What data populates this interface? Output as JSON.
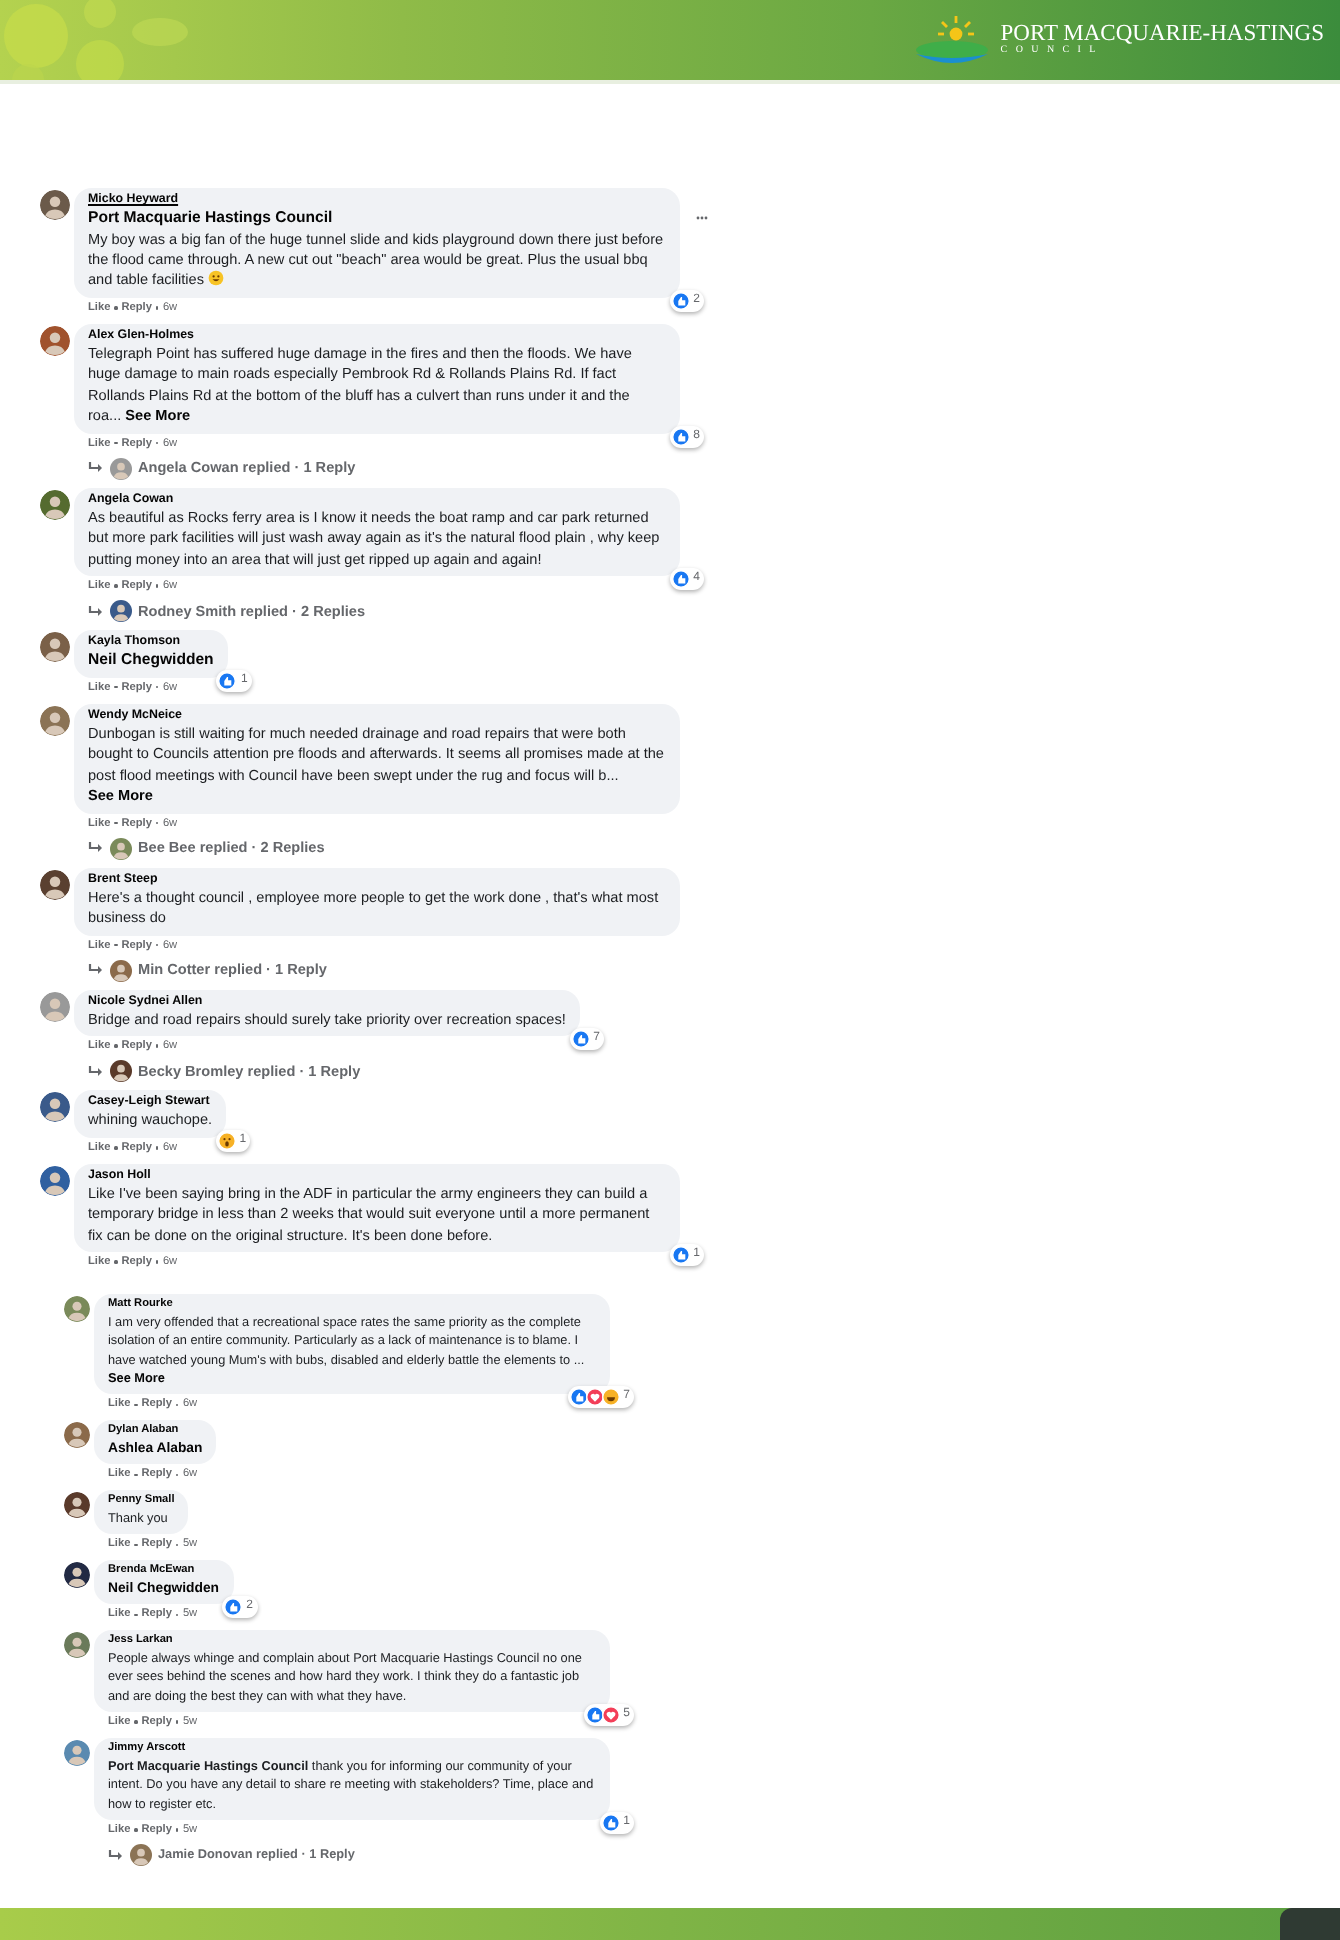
{
  "header": {
    "logo_title": "PORT MACQUARIE-HASTINGS",
    "logo_subtitle": "COUNCIL"
  },
  "groups": [
    {
      "kind": "main",
      "comments": [
        {
          "author": "Micko Heyward",
          "hovered": true,
          "mention": "Port Macquarie Hastings Council",
          "text": "My boy was a big fan of the huge tunnel slide and kids playground down there just before the flood came through. A new cut out \"beach\" area would be great. Plus the usual bbq and table facilities",
          "emoji": true,
          "reactions": {
            "icons": [
              {
                "kind": "like"
              }
            ],
            "count": "2"
          },
          "actions": [
            "Like",
            "Reply"
          ],
          "time": "6w"
        },
        {
          "author": "Alex Glen-Holmes",
          "hovered": false,
          "text": "Telegraph Point has suffered huge damage in the fires and then the floods. We have huge damage to main roads especially Pembrook Rd & Rollands Plains Rd. If fact Rollands Plains Rd at the bottom of the bluff has a culvert than runs under it and the roa...",
          "see_more": "See More",
          "reactions": {
            "icons": [
              {
                "kind": "like"
              }
            ],
            "count": "8"
          },
          "actions": [
            "Like",
            "Reply"
          ],
          "time": "6w",
          "replies": "Angela Cowan replied · 1 Reply"
        },
        {
          "author": "Angela Cowan",
          "hovered": false,
          "text": "As beautiful as Rocks ferry area is I know it needs the boat ramp and car park returned but more park facilities will just wash away again as it's the natural flood plain , why keep putting money into an area that will just get ripped up again and again!",
          "reactions": {
            "icons": [
              {
                "kind": "like"
              }
            ],
            "count": "4"
          },
          "actions": [
            "Like",
            "Reply"
          ],
          "time": "6w",
          "replies": "Rodney Smith replied · 2 Replies"
        },
        {
          "author": "Kayla Thomson",
          "hovered": false,
          "mention": "Neil Chegwidden",
          "reactions": {
            "icons": [
              {
                "kind": "like"
              }
            ],
            "count": "1"
          },
          "actions": [
            "Like",
            "Reply"
          ],
          "time": "6w"
        },
        {
          "author": "Wendy McNeice",
          "hovered": false,
          "text": "Dunbogan is still waiting for much needed drainage and road repairs that were both bought to Councils attention pre floods and afterwards. It seems all promises made at the post flood meetings with Council have been swept under the rug and focus will b...",
          "see_more": "See More",
          "actions": [
            "Like",
            "Reply"
          ],
          "time": "6w",
          "replies": "Bee Bee replied · 2 Replies"
        },
        {
          "author": "Brent Steep",
          "hovered": false,
          "text": "Here's a thought council , employee more people to get the work done , that's what most business do",
          "actions": [
            "Like",
            "Reply"
          ],
          "time": "6w",
          "replies": "Min Cotter replied · 1 Reply"
        },
        {
          "author": "Nicole Sydnei Allen",
          "hovered": false,
          "text": "Bridge and road repairs should surely take priority over recreation spaces!",
          "reactions": {
            "icons": [
              {
                "kind": "like"
              }
            ],
            "count": "7"
          },
          "actions": [
            "Like",
            "Reply"
          ],
          "time": "6w",
          "replies": "Becky Bromley replied · 1 Reply"
        },
        {
          "author": "Casey-Leigh Stewart",
          "hovered": false,
          "text": "whining wauchope.",
          "reactions": {
            "icons": [
              {
                "kind": "wow"
              }
            ],
            "count": "1"
          },
          "actions": [
            "Like",
            "Reply"
          ],
          "time": "6w"
        },
        {
          "author": "Jason Holl",
          "hovered": false,
          "text": "Like I've been saying bring in the ADF in particular the army engineers they can build a temporary bridge in less than 2 weeks that would suit everyone until a more permanent fix can be done on the original structure. It's been done before.",
          "reactions": {
            "icons": [
              {
                "kind": "like"
              }
            ],
            "count": "1"
          },
          "actions": [
            "Like",
            "Reply"
          ],
          "time": "6w"
        }
      ]
    },
    {
      "kind": "nested",
      "comments": [
        {
          "author": "Matt Rourke",
          "hovered": false,
          "text": "I am very offended that a recreational space rates the same priority as the complete isolation of an entire community. Particularly as a lack of maintenance is to blame. I have watched young Mum's with bubs, disabled and elderly battle the elements to ...",
          "see_more": "See More",
          "reactions": {
            "icons": [
              {
                "kind": "like"
              },
              {
                "kind": "love"
              },
              {
                "kind": "haha"
              }
            ],
            "count": "7"
          },
          "actions": [
            "Like",
            "Reply"
          ],
          "time": "6w"
        },
        {
          "author": "Dylan Alaban",
          "hovered": false,
          "mention": "Ashlea Alaban",
          "actions": [
            "Like",
            "Reply"
          ],
          "time": "6w"
        },
        {
          "author": "Penny Small",
          "hovered": false,
          "text": "Thank you",
          "actions": [
            "Like",
            "Reply"
          ],
          "time": "5w"
        },
        {
          "author": "Brenda McEwan",
          "hovered": false,
          "mention": "Neil Chegwidden",
          "reactions": {
            "icons": [
              {
                "kind": "like"
              }
            ],
            "count": "2"
          },
          "actions": [
            "Like",
            "Reply"
          ],
          "time": "5w"
        },
        {
          "author": "Jess Larkan",
          "hovered": false,
          "text": "People always whinge and complain about Port Macquarie Hastings Council no one ever sees behind the scenes and how hard they work. I think they do a fantastic job and are doing the best they can with what they have.",
          "reactions": {
            "icons": [
              {
                "kind": "like"
              },
              {
                "kind": "love"
              }
            ],
            "count": "5"
          },
          "actions": [
            "Like",
            "Reply"
          ],
          "time": "5w"
        },
        {
          "author": "Jimmy Arscott",
          "hovered": false,
          "text": "**Port Macquarie Hastings Council** thank you for informing our community of your intent. Do you have any detail to share re meeting with stakeholders? Time, place and how to register etc.",
          "reactions": {
            "icons": [
              {
                "kind": "like"
              }
            ],
            "count": "1"
          },
          "actions": [
            "Like",
            "Reply"
          ],
          "time": "5w",
          "replies": "Jamie Donovan replied · 1 Reply"
        }
      ]
    }
  ]
}
